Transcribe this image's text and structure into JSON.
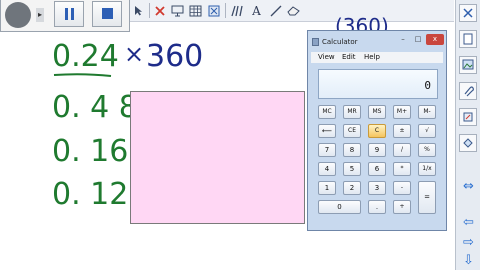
{
  "recorder": {
    "record_icon": "record-dot-icon",
    "menu_arrow": "▸",
    "pause_icon": "pause-icon",
    "stop_icon": "stop-icon"
  },
  "toolbar": {
    "tools": [
      "select-arrow-icon",
      "delete-x-icon",
      "screen-shade-icon",
      "table-icon",
      "capture-icon",
      "pens-icon",
      "text-icon",
      "line-icon",
      "eraser-icon"
    ],
    "text_tool_label": "A"
  },
  "board": {
    "problem_left": "0.24",
    "times_sign": "×",
    "problem_right": "360",
    "top_scribble": "(360)",
    "values": [
      "0. 4 8",
      "0. 16",
      "0. 12"
    ]
  },
  "calculator": {
    "title": "Calculator",
    "menu": [
      "View",
      "Edit",
      "Help"
    ],
    "display_value": "0",
    "memory_row": [
      "MC",
      "MR",
      "MS",
      "M+",
      "M-"
    ],
    "row2": [
      "⟵",
      "CE",
      "C",
      "±",
      "√"
    ],
    "row3": [
      "7",
      "8",
      "9",
      "/",
      "%"
    ],
    "row4": [
      "4",
      "5",
      "6",
      "*",
      "1/x"
    ],
    "row5": [
      "1",
      "2",
      "3",
      "-",
      "="
    ],
    "row6": [
      "0",
      ".",
      "+"
    ],
    "window_buttons": [
      "–",
      "□",
      "x"
    ]
  },
  "sidebar": {
    "items": [
      "page-sorter-icon",
      "gallery-icon",
      "attachments-icon",
      "properties-icon",
      "addons-icon"
    ],
    "arrows": [
      "⇔",
      "⇦",
      "⇨",
      "⇩"
    ]
  },
  "colors": {
    "handwriting_green": "#1f7a2f",
    "handwriting_blue": "#1e2c8a",
    "rectangle_fill": "#ffd7f4"
  }
}
